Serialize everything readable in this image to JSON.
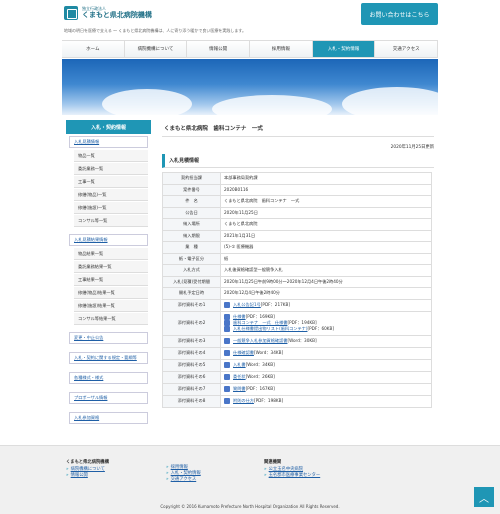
{
  "header": {
    "logo_small": "独立行政法人",
    "logo_main": "くまもと県北病院機構",
    "tagline": "地域の明日を医療で支える ～ くまもと県北病院機構は、人に寄り添う暖かで良い医療を実践します。",
    "contact_label": "お問い合わせはこちら"
  },
  "nav": [
    "ホーム",
    "病院機構について",
    "情報公開",
    "採用情報",
    "入札・契約情報",
    "交通アクセス"
  ],
  "sidebar": {
    "heading": "入札・契約情報",
    "items": [
      {
        "label": "入札見積情報",
        "type": "link"
      },
      {
        "label": "物品一覧",
        "type": "sub"
      },
      {
        "label": "委託業務一覧",
        "type": "sub"
      },
      {
        "label": "工事一覧",
        "type": "sub"
      },
      {
        "label": "修繕(物品)一覧",
        "type": "sub"
      },
      {
        "label": "修繕(施設)一覧",
        "type": "sub"
      },
      {
        "label": "コンサル等一覧",
        "type": "sub"
      },
      {
        "label": "入札見積結果情報",
        "type": "link"
      },
      {
        "label": "物品結果一覧",
        "type": "sub"
      },
      {
        "label": "委託業務結果一覧",
        "type": "sub"
      },
      {
        "label": "工事結果一覧",
        "type": "sub"
      },
      {
        "label": "修繕(物品)結果一覧",
        "type": "sub"
      },
      {
        "label": "修繕(施設)結果一覧",
        "type": "sub"
      },
      {
        "label": "コンサル等結果一覧",
        "type": "sub"
      },
      {
        "label": "変更・中止公告",
        "type": "link"
      },
      {
        "label": "入札・契約に関する規定・要綱等",
        "type": "link"
      },
      {
        "label": "各種様式・様式",
        "type": "link"
      },
      {
        "label": "プロポーザル情報",
        "type": "link"
      },
      {
        "label": "入札参加資格",
        "type": "link"
      }
    ]
  },
  "main": {
    "title": "くまもと県北病院　歯科コンテナ　一式",
    "date": "2020年11月25日更新",
    "section_title": "入札見積情報",
    "rows": [
      {
        "k": "契約担当課",
        "v": "本部事務局契約課"
      },
      {
        "k": "案件番号",
        "v": "2020B0116"
      },
      {
        "k": "件　名",
        "v": "くまもと県北病院　歯科コンテナ　一式"
      },
      {
        "k": "公告日",
        "v": "2020年11月25日"
      },
      {
        "k": "納入場所",
        "v": "くまもと県北病院"
      },
      {
        "k": "納入期限",
        "v": "2021年1月31日"
      },
      {
        "k": "業　種",
        "v": "(5)-① 医療機器"
      },
      {
        "k": "紙・電子区分",
        "v": "紙"
      },
      {
        "k": "入札方式",
        "v": "入札後資格確認型一般競争入札"
      },
      {
        "k": "入札(見積)受付期間",
        "v": "2020年11月25日午前9時00分～2020年12月4日午後2時40分"
      },
      {
        "k": "開札予定日時",
        "v": "2020年12月4日午後2時40分"
      }
    ],
    "attachments": [
      {
        "k": "添付資料その1",
        "files": [
          {
            "name": "入札公告記1号",
            "meta": "[PDF：217KB]"
          }
        ]
      },
      {
        "k": "添付資料その2",
        "files": [
          {
            "name": "仕様書",
            "meta": "[PDF：169KB]"
          },
          {
            "name": "歯科コンテナ　一式　仕様書",
            "meta": "[PDF：194KB]"
          },
          {
            "name": "入札仕様書提出物リスト(歯科コンテナ)",
            "meta": "[PDF：60KB]"
          }
        ]
      },
      {
        "k": "添付資料その3",
        "files": [
          {
            "name": "一般競争入札参加資格確認書",
            "meta": "[Word：30KB]"
          }
        ]
      },
      {
        "k": "添付資料その4",
        "files": [
          {
            "name": "仕様確認書",
            "meta": "[Word：34KB]"
          }
        ]
      },
      {
        "k": "添付資料その5",
        "files": [
          {
            "name": "入札書",
            "meta": "[Word：34KB]"
          }
        ]
      },
      {
        "k": "添付資料その6",
        "files": [
          {
            "name": "委任状",
            "meta": "[Word：26KB]"
          }
        ]
      },
      {
        "k": "添付資料その7",
        "files": [
          {
            "name": "質問書",
            "meta": "[PDF：167KB]"
          }
        ]
      },
      {
        "k": "添付資料その8",
        "files": [
          {
            "name": "附則の仕方",
            "meta": "[PDF：198KB]"
          }
        ]
      }
    ]
  },
  "footer": {
    "col1_title": "くまもと県北病院機構",
    "col1_links": [
      "病院機構について",
      "情報公開"
    ],
    "col2_links": [
      "採用情報",
      "入札・契約情報",
      "交通アクセス"
    ],
    "col3_title": "関連機関",
    "col3_links": [
      "公立玉名中央病院",
      "玉名郡市医療事業センター"
    ],
    "copyright": "Copyright © 2016 Kumamoto Prefecture North Hospital Organization All Rights Reserved.",
    "back_to_top": "へ"
  },
  "colors": {
    "accent": "#1f96b5",
    "link": "#1f5fa6"
  }
}
